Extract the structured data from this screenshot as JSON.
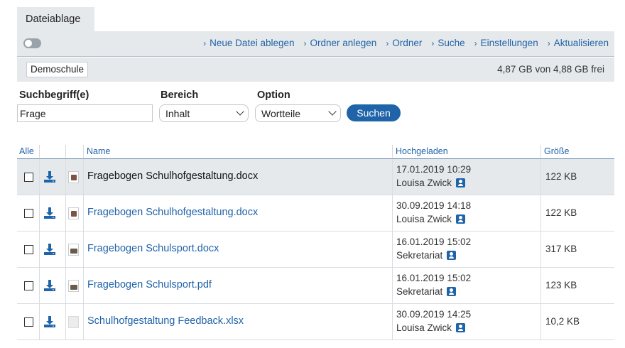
{
  "tab": {
    "label": "Dateiablage"
  },
  "toolbar": {
    "actions": [
      {
        "label": "Neue Datei ablegen",
        "icon": "chevron-right-icon"
      },
      {
        "label": "Ordner anlegen",
        "icon": "chevron-right-icon"
      },
      {
        "label": "Ordner",
        "icon": "chevron-right-icon"
      },
      {
        "label": "Suche",
        "icon": "chevron-right-icon"
      },
      {
        "label": "Einstellungen",
        "icon": "chevron-right-icon"
      },
      {
        "label": "Aktualisieren",
        "icon": "chevron-right-icon"
      }
    ],
    "chevron": "›"
  },
  "storage": {
    "school": "Demoschule",
    "quota": "4,87 GB von 4,88 GB frei"
  },
  "search": {
    "term_label": "Suchbegriff(e)",
    "term_value": "Frage",
    "area_label": "Bereich",
    "area_value": "Inhalt",
    "option_label": "Option",
    "option_value": "Wortteile",
    "submit_label": "Suchen"
  },
  "table": {
    "headers": {
      "all": "Alle",
      "name": "Name",
      "uploaded": "Hochgeladen",
      "size": "Größe"
    },
    "rows": [
      {
        "name": "Fragebogen Schulhofgestaltung.docx",
        "date": "17.01.2019 10:29",
        "user": "Louisa Zwick",
        "size": "122 KB",
        "thumb": "document",
        "highlighted": true
      },
      {
        "name": "Fragebogen Schulhofgestaltung.docx",
        "date": "30.09.2019 14:18",
        "user": "Louisa Zwick",
        "size": "122 KB",
        "thumb": "document",
        "highlighted": false
      },
      {
        "name": "Fragebogen Schulsport.docx",
        "date": "16.01.2019 15:02",
        "user": "Sekretariat",
        "size": "317 KB",
        "thumb": "photo",
        "highlighted": false
      },
      {
        "name": "Fragebogen Schulsport.pdf",
        "date": "16.01.2019 15:02",
        "user": "Sekretariat",
        "size": "123 KB",
        "thumb": "photo",
        "highlighted": false
      },
      {
        "name": "Schulhofgestaltung Feedback.xlsx",
        "date": "30.09.2019 14:25",
        "user": "Louisa Zwick",
        "size": "10,2 KB",
        "thumb": "blank",
        "highlighted": false
      }
    ]
  },
  "colors": {
    "accent": "#1f63a8",
    "panel": "#e6e9ec"
  }
}
